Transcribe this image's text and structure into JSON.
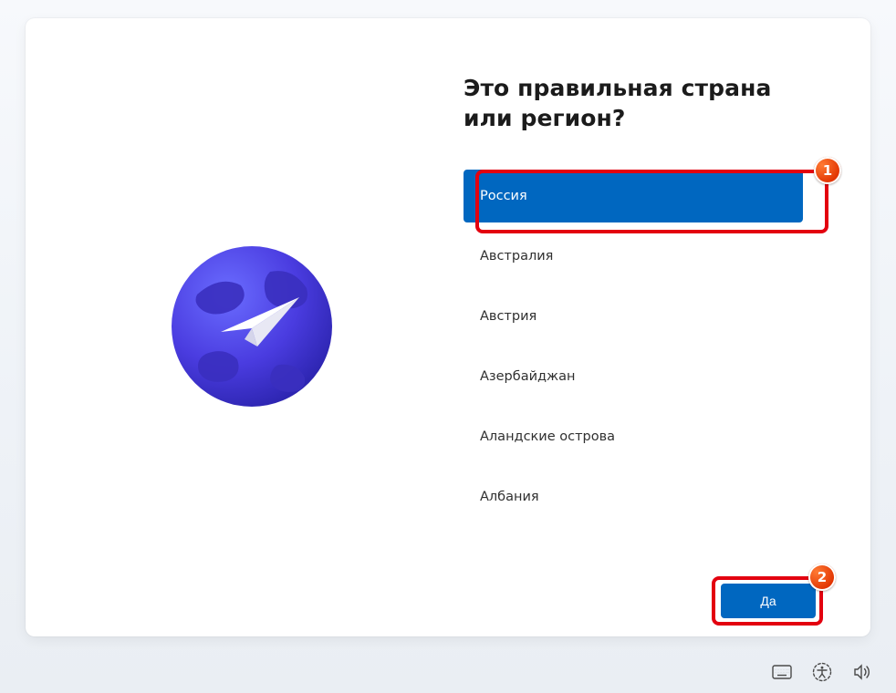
{
  "heading": "Это правильная страна или регион?",
  "regions": {
    "items": [
      {
        "label": "Россия",
        "selected": true
      },
      {
        "label": "Австралия",
        "selected": false
      },
      {
        "label": "Австрия",
        "selected": false
      },
      {
        "label": "Азербайджан",
        "selected": false
      },
      {
        "label": "Аландские острова",
        "selected": false
      },
      {
        "label": "Албания",
        "selected": false
      }
    ]
  },
  "confirm": {
    "label": "Да"
  },
  "annotations": {
    "badge1": "1",
    "badge2": "2"
  },
  "icons": {
    "keyboard": "keyboard-icon",
    "accessibility": "accessibility-icon",
    "volume": "volume-icon"
  }
}
